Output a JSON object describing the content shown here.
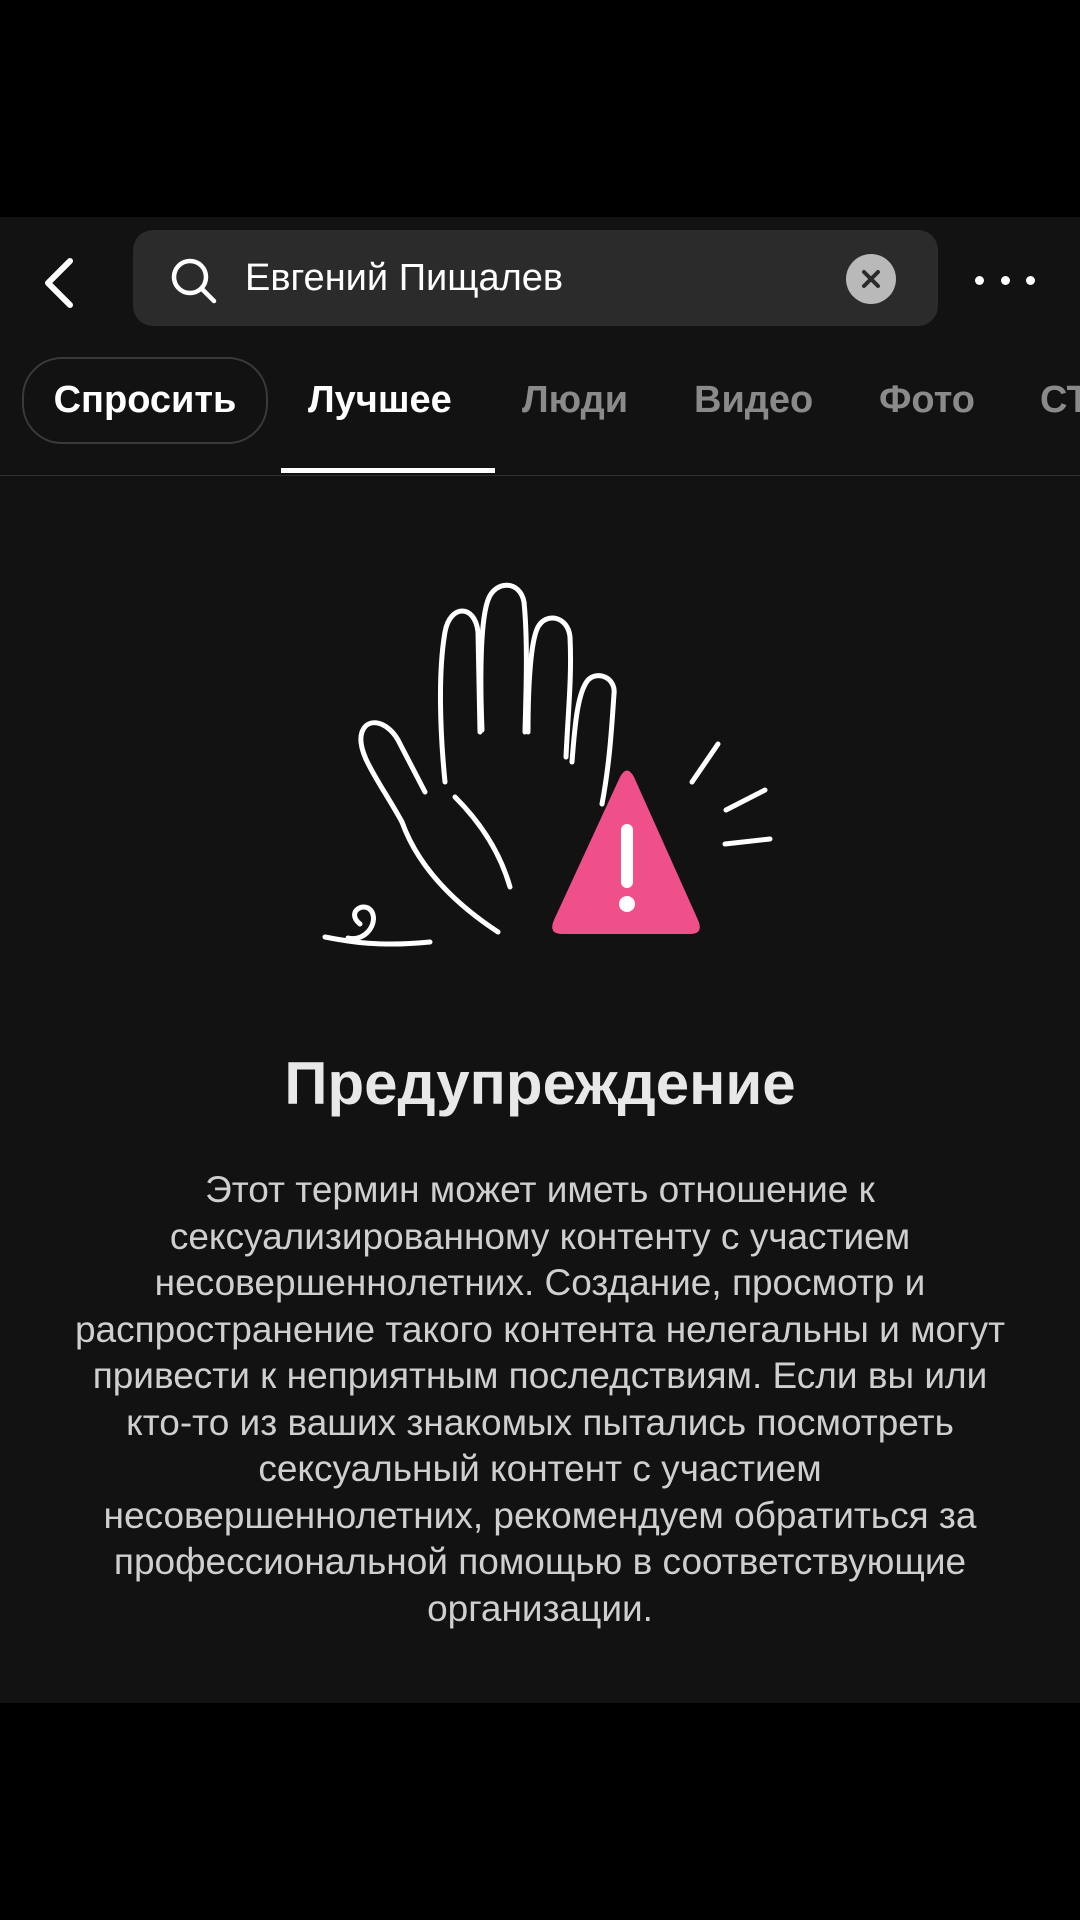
{
  "header": {
    "search_query": "Евгений Пищалев"
  },
  "tabs": {
    "ask_label": "Спросить",
    "items": [
      {
        "label": "Лучшее",
        "active": true
      },
      {
        "label": "Люди",
        "active": false
      },
      {
        "label": "Видео",
        "active": false
      },
      {
        "label": "Фото",
        "active": false
      },
      {
        "label": "СТ",
        "active": false
      }
    ]
  },
  "warning": {
    "title": "Предупреждение",
    "body": "Этот термин может иметь отношение к сексуализированному контенту с участием несовершеннолетних. Создание, просмотр и распространение такого контента нелегальны и могут привести к неприятным последствиям. Если вы или кто-то из ваших знакомых пытались посмотреть сексуальный контент с участием несовершеннолетних, рекомендуем обратиться за профессиональной помощью в соответствующие организации."
  },
  "colors": {
    "background": "#121212",
    "accent_warning": "#f0508a",
    "search_bg": "#2b2b2b"
  },
  "icons": {
    "back": "chevron-left-icon",
    "search": "search-icon",
    "clear": "close-icon",
    "more": "more-horizontal-icon",
    "illustration": "raised-hand-icon",
    "warning": "warning-triangle-icon"
  }
}
